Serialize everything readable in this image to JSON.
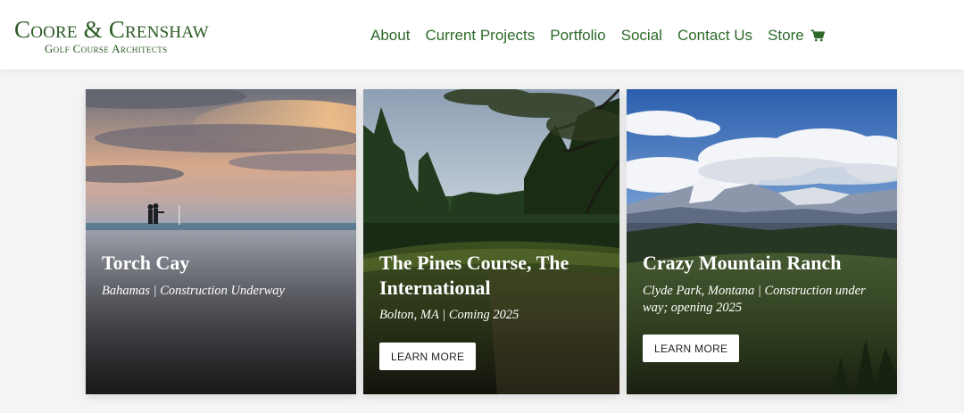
{
  "brand": {
    "name": "Coore & Crenshaw",
    "tagline": "Golf Course Architects",
    "color": "#2b5a24"
  },
  "nav": {
    "items": [
      "About",
      "Current Projects",
      "Portfolio",
      "Social",
      "Contact Us",
      "Store"
    ],
    "store_icon": "shopping-cart-icon",
    "link_color": "#2d6a2a"
  },
  "projects": [
    {
      "title": "Torch Cay",
      "subtitle": "Bahamas | Construction Underway"
    },
    {
      "title": "The Pines Course, The International",
      "subtitle": "Bolton, MA | Coming 2025",
      "button_label": "LEARN MORE"
    },
    {
      "title": "Crazy Mountain Ranch",
      "subtitle": "Clyde Park, Montana | Construction under way; opening 2025",
      "button_label": "LEARN MORE"
    }
  ]
}
